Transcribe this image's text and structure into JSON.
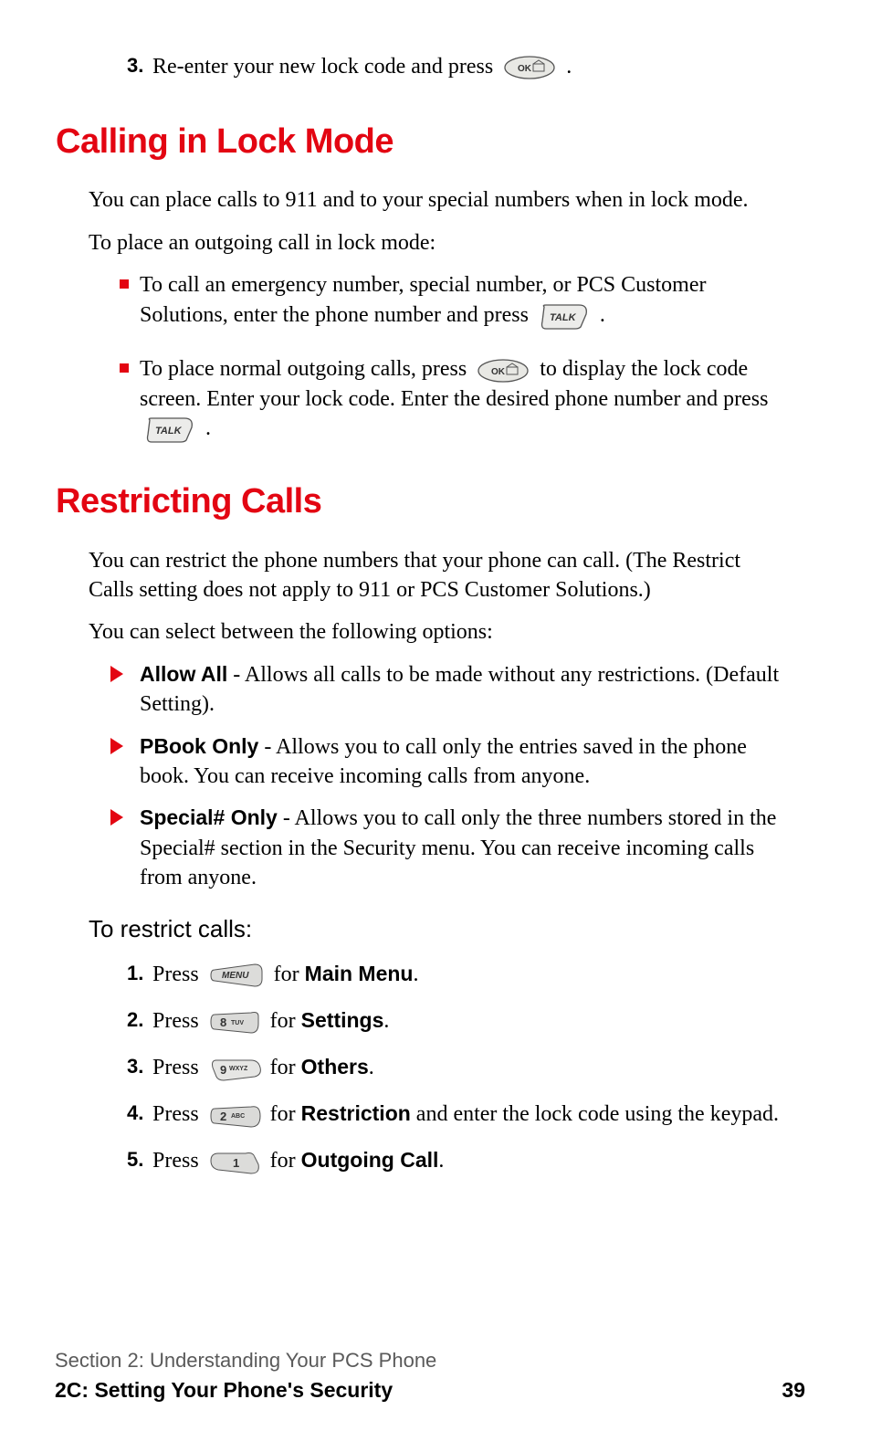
{
  "step3": {
    "num": "3.",
    "text_a": "Re-enter your new lock code and press ",
    "text_b": "."
  },
  "heading1": "Calling in Lock Mode",
  "p1": "You can place calls to 911 and to your special numbers when in lock mode.",
  "p2": "To place an outgoing call in lock mode:",
  "bullets1": {
    "b1a": "To call an emergency number, special number, or PCS Customer Solutions, enter the phone number and press ",
    "b1b": ".",
    "b2a": "To place normal outgoing calls, press ",
    "b2b": " to display the lock code screen. Enter your lock code. Enter the desired phone number and press ",
    "b2c": "."
  },
  "heading2": "Restricting Calls",
  "p3": "You can restrict the phone numbers that your phone can call. (The Restrict Calls setting does not apply to 911 or PCS Customer Solutions.)",
  "p4": "You can select between the following options:",
  "options": {
    "o1_name": "Allow All",
    "o1_desc": " - Allows all calls to be made without any restrictions. (Default Setting).",
    "o2_name": "PBook Only",
    "o2_desc": " - Allows you to call only the entries saved in the phone book. You can receive incoming calls from anyone.",
    "o3_name": "Special# Only",
    "o3_desc": " - Allows you to call only the three numbers stored in the Special# section in the Security menu. You can receive incoming calls from anyone."
  },
  "sublead": "To restrict calls:",
  "steps": {
    "s1": {
      "num": "1.",
      "a": "Press ",
      "b": " for ",
      "bold": "Main Menu",
      "c": "."
    },
    "s2": {
      "num": "2.",
      "a": "Press ",
      "b": " for ",
      "bold": "Settings",
      "c": "."
    },
    "s3": {
      "num": "3.",
      "a": "Press ",
      "b": "  for ",
      "bold": "Others",
      "c": "."
    },
    "s4": {
      "num": "4.",
      "a": "Press ",
      "b": "  for ",
      "bold": "Restriction",
      "c": " and enter the lock code using the keypad."
    },
    "s5": {
      "num": "5.",
      "a": "Press ",
      "b": "  for ",
      "bold": "Outgoing Call",
      "c": "."
    }
  },
  "keys": {
    "ok": "OK",
    "talk": "TALK",
    "menu": "MENU",
    "k8": "8 TUV",
    "k9": "9 WXYZ",
    "k2": "2 ABC",
    "k1": "1"
  },
  "footer": {
    "section": "Section 2: Understanding Your PCS Phone",
    "chapter": "2C: Setting Your Phone's Security",
    "page": "39"
  }
}
